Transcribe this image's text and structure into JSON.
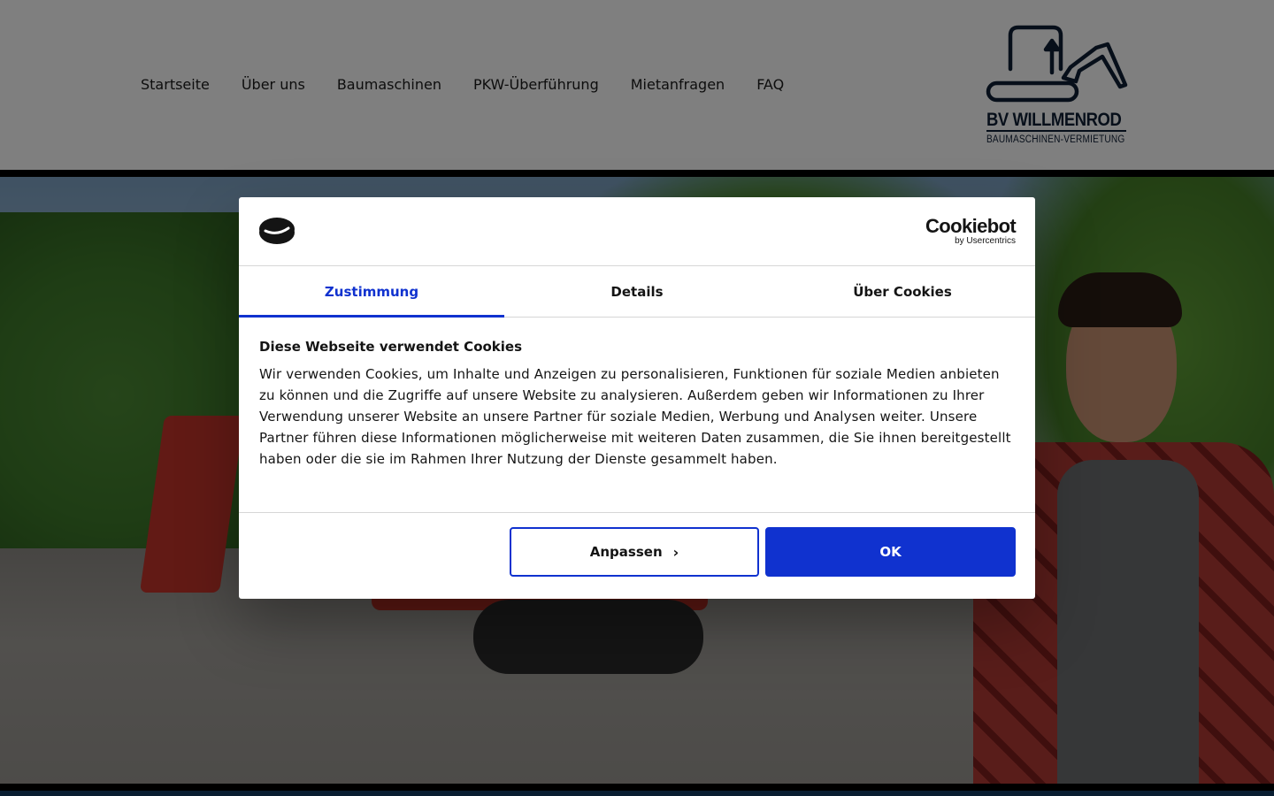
{
  "nav": {
    "items": [
      "Startseite",
      "Über uns",
      "Baumaschinen",
      "PKW-Überführung",
      "Mietanfragen",
      "FAQ"
    ]
  },
  "logo": {
    "name": "BV WILLMENROD",
    "subtitle": "BAUMASCHINEN-VERMIETUNG"
  },
  "cookie_dialog": {
    "brand": "Cookiebot",
    "brand_by": "by Usercentrics",
    "tabs": [
      "Zustimmung",
      "Details",
      "Über Cookies"
    ],
    "active_tab": "Zustimmung",
    "heading": "Diese Webseite verwendet Cookies",
    "body": "Wir verwenden Cookies, um Inhalte und Anzeigen zu personalisieren, Funktionen für soziale Medien anbieten zu können und die Zugriffe auf unsere Website zu analysieren. Außerdem geben wir Informationen zu Ihrer Verwendung unserer Website an unsere Partner für soziale Medien, Werbung und Analysen weiter. Unsere Partner führen diese Informationen möglicherweise mit weiteren Daten zusammen, die Sie ihnen bereitgestellt haben oder die sie im Rahmen Ihrer Nutzung der Dienste gesammelt haben.",
    "customize_label": "Anpassen",
    "ok_label": "OK"
  },
  "colors": {
    "accent": "#1032cf",
    "logo_navy": "#0f1f35",
    "overlay": "rgba(0,0,0,0.5)"
  },
  "icons": [
    "cookie-icon",
    "excavator-logo-icon",
    "chevron-right-icon"
  ]
}
